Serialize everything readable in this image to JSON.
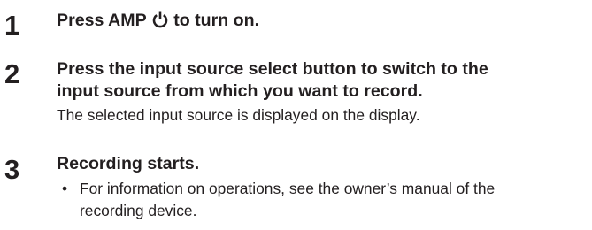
{
  "steps": [
    {
      "number": "1",
      "heading_before_icon": "Press AMP",
      "heading_after_icon": "to turn on.",
      "icon": "power-icon"
    },
    {
      "number": "2",
      "heading_line1": "Press the input source select button to switch to the",
      "heading_line2": "input source from which you want to record.",
      "body": "The selected input source is displayed on the display."
    },
    {
      "number": "3",
      "heading": "Recording starts.",
      "bullet_marker": "•",
      "bullet_line1": "For information on operations, see the owner’s manual of the",
      "bullet_line2": "recording device."
    }
  ]
}
